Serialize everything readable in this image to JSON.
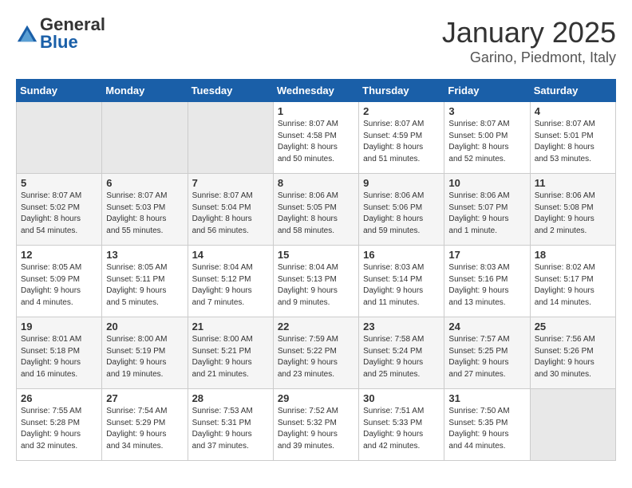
{
  "header": {
    "logo_general": "General",
    "logo_blue": "Blue",
    "month": "January 2025",
    "location": "Garino, Piedmont, Italy"
  },
  "weekdays": [
    "Sunday",
    "Monday",
    "Tuesday",
    "Wednesday",
    "Thursday",
    "Friday",
    "Saturday"
  ],
  "weeks": [
    [
      {
        "day": "",
        "info": ""
      },
      {
        "day": "",
        "info": ""
      },
      {
        "day": "",
        "info": ""
      },
      {
        "day": "1",
        "info": "Sunrise: 8:07 AM\nSunset: 4:58 PM\nDaylight: 8 hours\nand 50 minutes."
      },
      {
        "day": "2",
        "info": "Sunrise: 8:07 AM\nSunset: 4:59 PM\nDaylight: 8 hours\nand 51 minutes."
      },
      {
        "day": "3",
        "info": "Sunrise: 8:07 AM\nSunset: 5:00 PM\nDaylight: 8 hours\nand 52 minutes."
      },
      {
        "day": "4",
        "info": "Sunrise: 8:07 AM\nSunset: 5:01 PM\nDaylight: 8 hours\nand 53 minutes."
      }
    ],
    [
      {
        "day": "5",
        "info": "Sunrise: 8:07 AM\nSunset: 5:02 PM\nDaylight: 8 hours\nand 54 minutes."
      },
      {
        "day": "6",
        "info": "Sunrise: 8:07 AM\nSunset: 5:03 PM\nDaylight: 8 hours\nand 55 minutes."
      },
      {
        "day": "7",
        "info": "Sunrise: 8:07 AM\nSunset: 5:04 PM\nDaylight: 8 hours\nand 56 minutes."
      },
      {
        "day": "8",
        "info": "Sunrise: 8:06 AM\nSunset: 5:05 PM\nDaylight: 8 hours\nand 58 minutes."
      },
      {
        "day": "9",
        "info": "Sunrise: 8:06 AM\nSunset: 5:06 PM\nDaylight: 8 hours\nand 59 minutes."
      },
      {
        "day": "10",
        "info": "Sunrise: 8:06 AM\nSunset: 5:07 PM\nDaylight: 9 hours\nand 1 minute."
      },
      {
        "day": "11",
        "info": "Sunrise: 8:06 AM\nSunset: 5:08 PM\nDaylight: 9 hours\nand 2 minutes."
      }
    ],
    [
      {
        "day": "12",
        "info": "Sunrise: 8:05 AM\nSunset: 5:09 PM\nDaylight: 9 hours\nand 4 minutes."
      },
      {
        "day": "13",
        "info": "Sunrise: 8:05 AM\nSunset: 5:11 PM\nDaylight: 9 hours\nand 5 minutes."
      },
      {
        "day": "14",
        "info": "Sunrise: 8:04 AM\nSunset: 5:12 PM\nDaylight: 9 hours\nand 7 minutes."
      },
      {
        "day": "15",
        "info": "Sunrise: 8:04 AM\nSunset: 5:13 PM\nDaylight: 9 hours\nand 9 minutes."
      },
      {
        "day": "16",
        "info": "Sunrise: 8:03 AM\nSunset: 5:14 PM\nDaylight: 9 hours\nand 11 minutes."
      },
      {
        "day": "17",
        "info": "Sunrise: 8:03 AM\nSunset: 5:16 PM\nDaylight: 9 hours\nand 13 minutes."
      },
      {
        "day": "18",
        "info": "Sunrise: 8:02 AM\nSunset: 5:17 PM\nDaylight: 9 hours\nand 14 minutes."
      }
    ],
    [
      {
        "day": "19",
        "info": "Sunrise: 8:01 AM\nSunset: 5:18 PM\nDaylight: 9 hours\nand 16 minutes."
      },
      {
        "day": "20",
        "info": "Sunrise: 8:00 AM\nSunset: 5:19 PM\nDaylight: 9 hours\nand 19 minutes."
      },
      {
        "day": "21",
        "info": "Sunrise: 8:00 AM\nSunset: 5:21 PM\nDaylight: 9 hours\nand 21 minutes."
      },
      {
        "day": "22",
        "info": "Sunrise: 7:59 AM\nSunset: 5:22 PM\nDaylight: 9 hours\nand 23 minutes."
      },
      {
        "day": "23",
        "info": "Sunrise: 7:58 AM\nSunset: 5:24 PM\nDaylight: 9 hours\nand 25 minutes."
      },
      {
        "day": "24",
        "info": "Sunrise: 7:57 AM\nSunset: 5:25 PM\nDaylight: 9 hours\nand 27 minutes."
      },
      {
        "day": "25",
        "info": "Sunrise: 7:56 AM\nSunset: 5:26 PM\nDaylight: 9 hours\nand 30 minutes."
      }
    ],
    [
      {
        "day": "26",
        "info": "Sunrise: 7:55 AM\nSunset: 5:28 PM\nDaylight: 9 hours\nand 32 minutes."
      },
      {
        "day": "27",
        "info": "Sunrise: 7:54 AM\nSunset: 5:29 PM\nDaylight: 9 hours\nand 34 minutes."
      },
      {
        "day": "28",
        "info": "Sunrise: 7:53 AM\nSunset: 5:31 PM\nDaylight: 9 hours\nand 37 minutes."
      },
      {
        "day": "29",
        "info": "Sunrise: 7:52 AM\nSunset: 5:32 PM\nDaylight: 9 hours\nand 39 minutes."
      },
      {
        "day": "30",
        "info": "Sunrise: 7:51 AM\nSunset: 5:33 PM\nDaylight: 9 hours\nand 42 minutes."
      },
      {
        "day": "31",
        "info": "Sunrise: 7:50 AM\nSunset: 5:35 PM\nDaylight: 9 hours\nand 44 minutes."
      },
      {
        "day": "",
        "info": ""
      }
    ]
  ]
}
